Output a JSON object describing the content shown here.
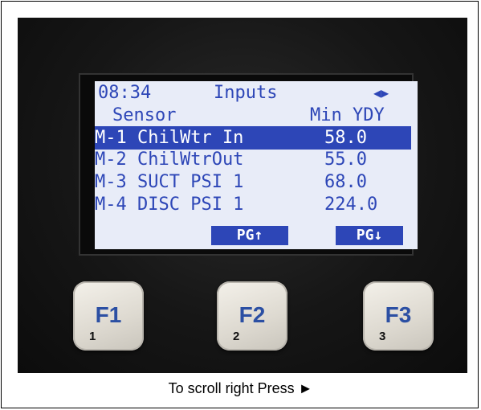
{
  "display": {
    "time": "08:34",
    "title": "Inputs",
    "scroll_arrows": "◀▶",
    "column_sensor": "Sensor",
    "column_units": "Min YDY",
    "rows": [
      {
        "name": "M-1 ChilWtr In",
        "value": "58.0",
        "selected": true
      },
      {
        "name": "M-2 ChilWtrOut",
        "value": "55.0",
        "selected": false
      },
      {
        "name": "M-3 SUCT PSI 1",
        "value": "68.0",
        "selected": false
      },
      {
        "name": "M-4 DISC PSI 1",
        "value": "224.0",
        "selected": false
      }
    ],
    "softkeys": [
      "PG↑",
      "PG↓"
    ],
    "colors": {
      "lcd_background": "#e8ecf8",
      "lcd_text": "#2d46b7",
      "highlight": "#2d46b7"
    }
  },
  "keys": [
    {
      "label": "F1",
      "number": "1"
    },
    {
      "label": "F2",
      "number": "2"
    },
    {
      "label": "F3",
      "number": "3"
    }
  ],
  "caption": "To scroll right Press ►"
}
